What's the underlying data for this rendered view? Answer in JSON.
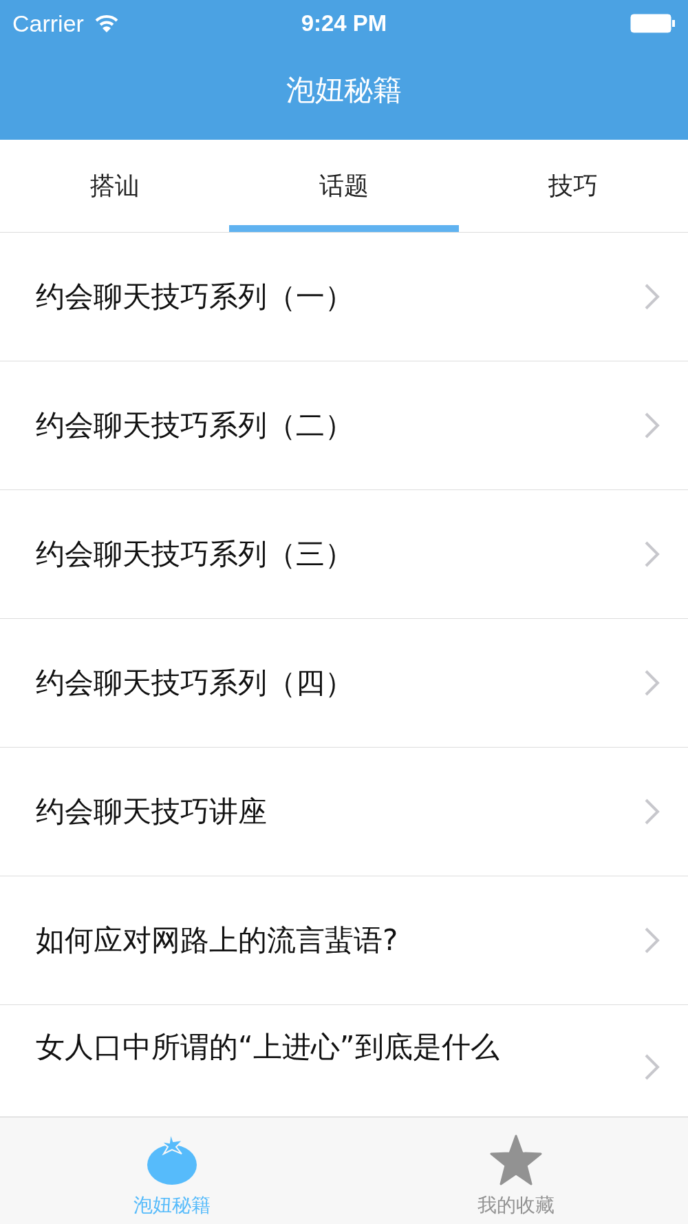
{
  "status_bar": {
    "carrier": "Carrier",
    "time": "9:24 PM"
  },
  "nav_bar": {
    "title": "泡妞秘籍"
  },
  "tabs": [
    {
      "label": "搭讪",
      "selected": false
    },
    {
      "label": "话题",
      "selected": true
    },
    {
      "label": "技巧",
      "selected": false
    }
  ],
  "list": [
    {
      "title": "约会聊天技巧系列（一）"
    },
    {
      "title": "约会聊天技巧系列（二）"
    },
    {
      "title": "约会聊天技巧系列（三）"
    },
    {
      "title": "约会聊天技巧系列（四）"
    },
    {
      "title": "约会聊天技巧讲座"
    },
    {
      "title": "如何应对网路上的流言蜚语?"
    },
    {
      "title": "女人口中所谓的“上进心”到底是什么"
    }
  ],
  "tab_bar": [
    {
      "label": "泡妞秘籍",
      "kind": "tomato",
      "selected": true
    },
    {
      "label": "我的收藏",
      "kind": "star",
      "selected": false
    }
  ]
}
